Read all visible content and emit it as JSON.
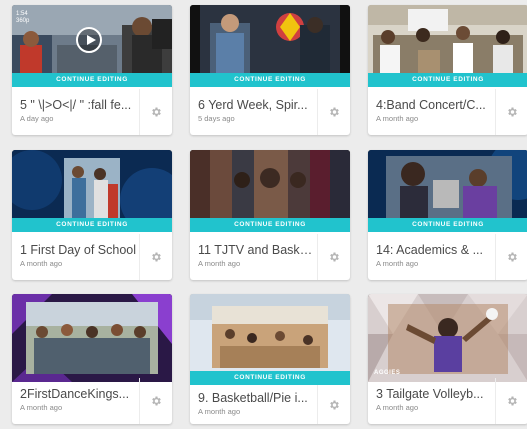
{
  "cta_label": "CONTINUE EDITING",
  "projects": [
    {
      "title": "5 \" \\|>O<|/ \" :fall fe...",
      "date": "A day ago",
      "timecode_line1": "1:54",
      "timecode_line2": "360p"
    },
    {
      "title": "6 Yerd Week, Spir...",
      "date": "5 days ago"
    },
    {
      "title": "4:Band Concert/C...",
      "date": "A month ago"
    },
    {
      "title": "1 First Day of School",
      "date": "A month ago"
    },
    {
      "title": "11 TJTV and Baske...",
      "date": "A month ago"
    },
    {
      "title": "14: Academics & ...",
      "date": "A month ago"
    },
    {
      "title": "2FirstDanceKings...",
      "date": "A month ago"
    },
    {
      "title": "9. Basketball/Pie i...",
      "date": "A month ago"
    },
    {
      "title": "3 Tailgate Volleyb...",
      "date": "A month ago",
      "watermark": "AGGIES"
    }
  ],
  "icons": {
    "gear": "gear-icon",
    "play": "play-icon"
  },
  "colors": {
    "accent": "#21c3cd",
    "background": "#ececec"
  }
}
